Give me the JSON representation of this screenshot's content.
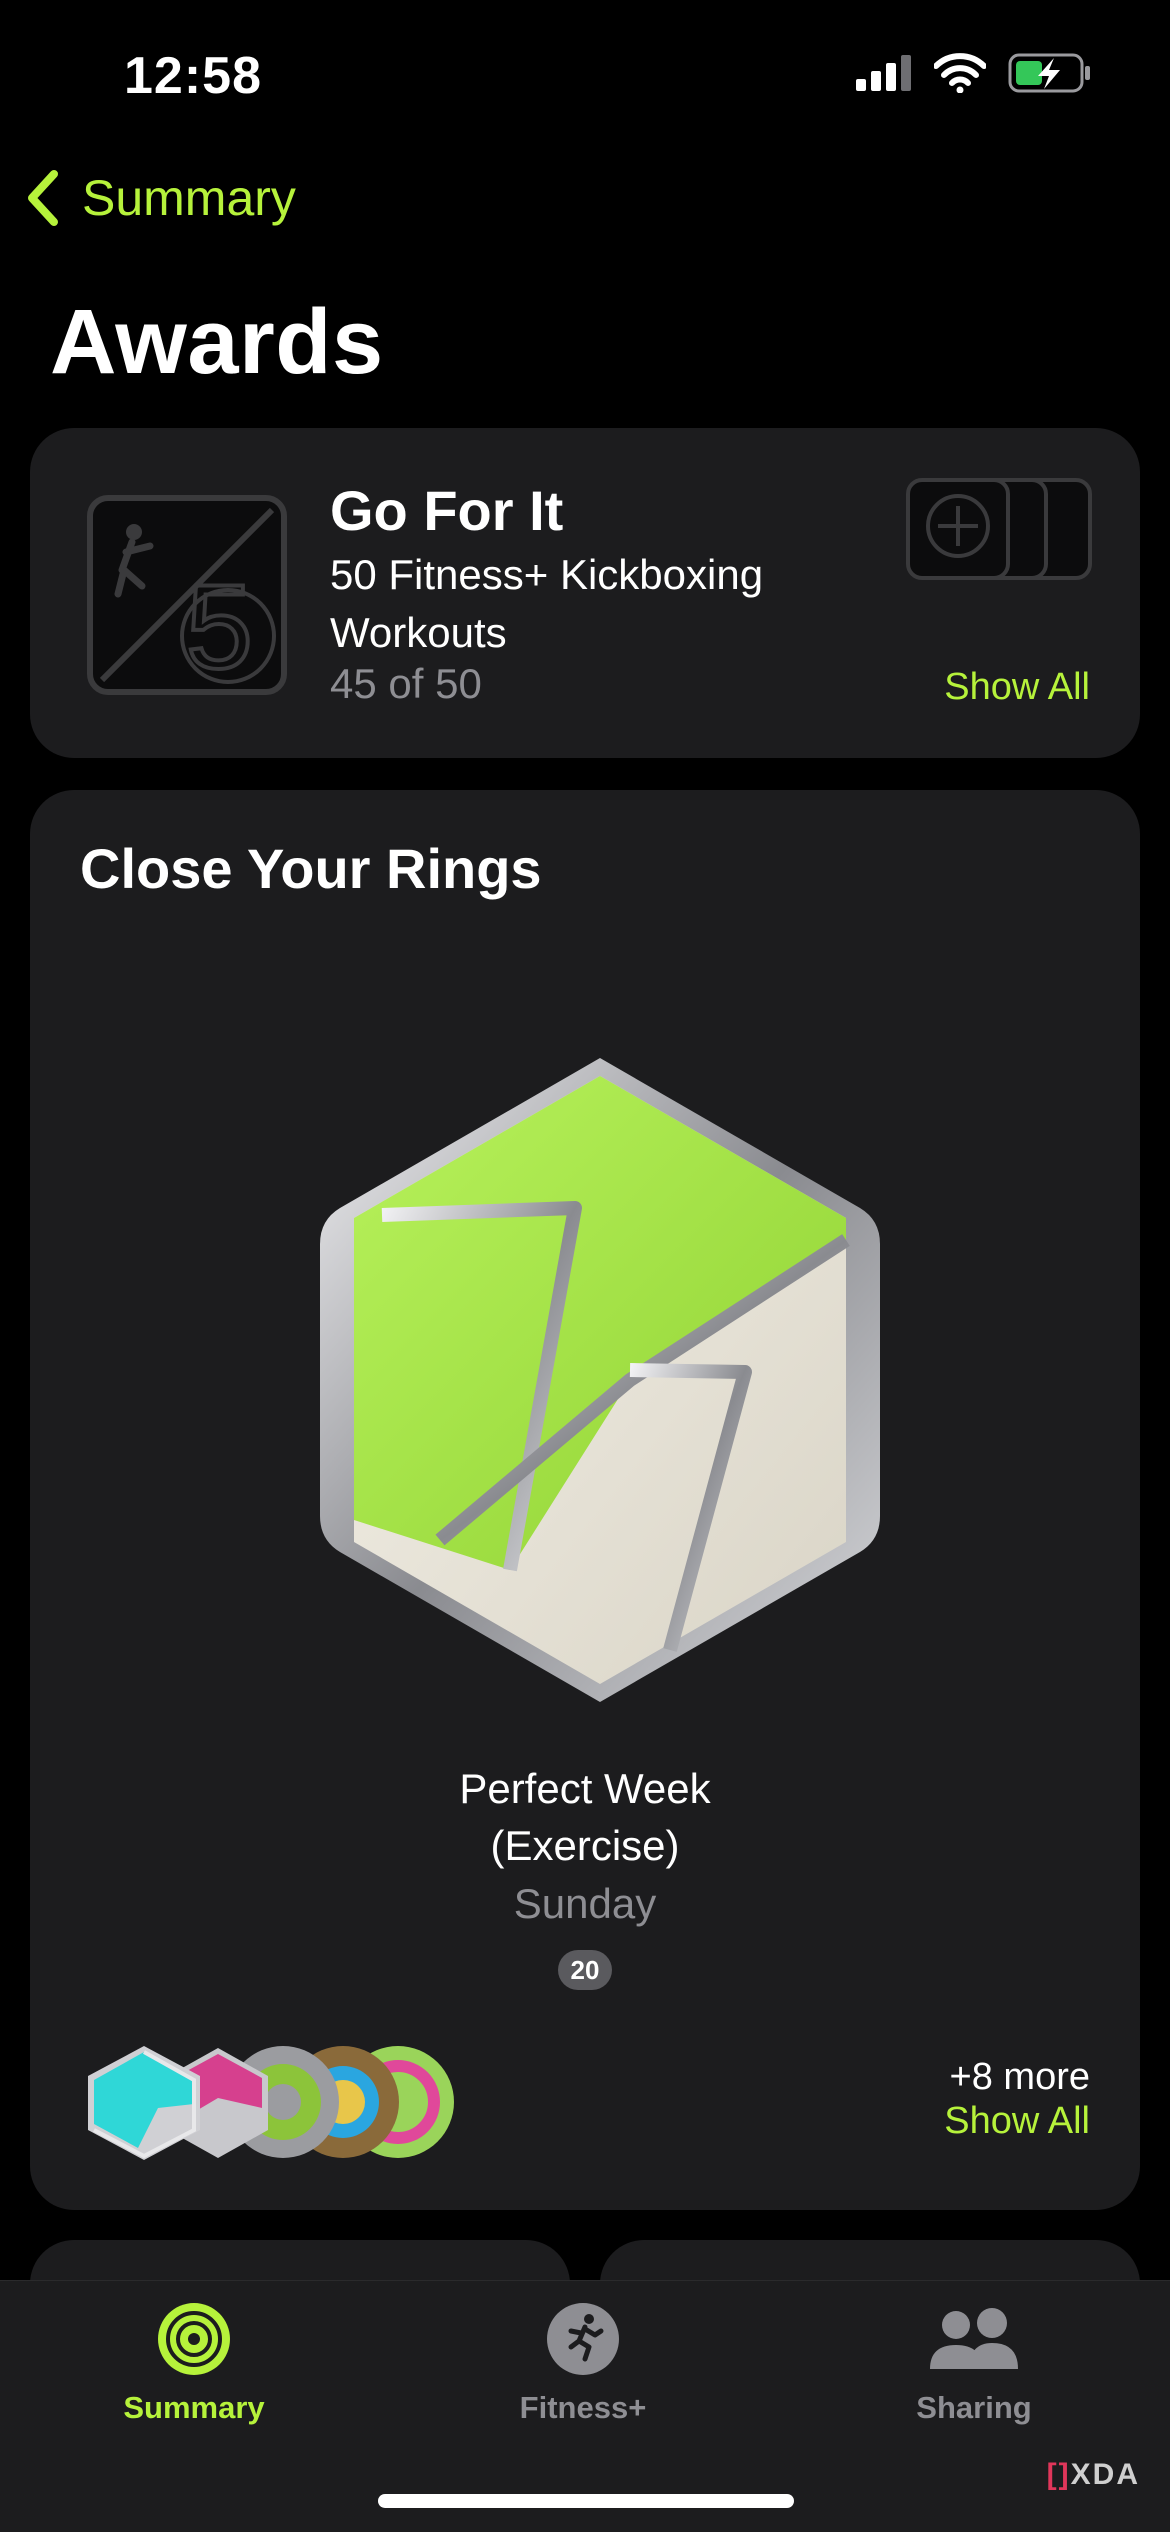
{
  "status_bar": {
    "time": "12:58"
  },
  "nav": {
    "back_label": "Summary",
    "title": "Awards"
  },
  "goal_card": {
    "title": "Go For It",
    "description": "50 Fitness+ Kickboxing Workouts",
    "progress": "45 of 50",
    "progress_value": 45,
    "progress_total": 50,
    "show_all": "Show All"
  },
  "rings_card": {
    "title": "Close Your Rings",
    "award_name": "Perfect Week (Exercise)",
    "award_date": "Sunday",
    "award_count": "20",
    "more_text": "+8 more",
    "show_all": "Show All"
  },
  "tabs": [
    {
      "label": "Summary",
      "icon": "activity-rings-icon",
      "active": true
    },
    {
      "label": "Fitness+",
      "icon": "runner-icon",
      "active": false
    },
    {
      "label": "Sharing",
      "icon": "people-icon",
      "active": false
    }
  ],
  "watermark": {
    "bracket": "[]",
    "text": "XDA"
  },
  "colors": {
    "accent": "#b6f23b",
    "card": "#1c1c1e",
    "secondary_text": "#8e8e93",
    "badge_green": "#a7e34a",
    "badge_cream": "#ece8dc"
  }
}
